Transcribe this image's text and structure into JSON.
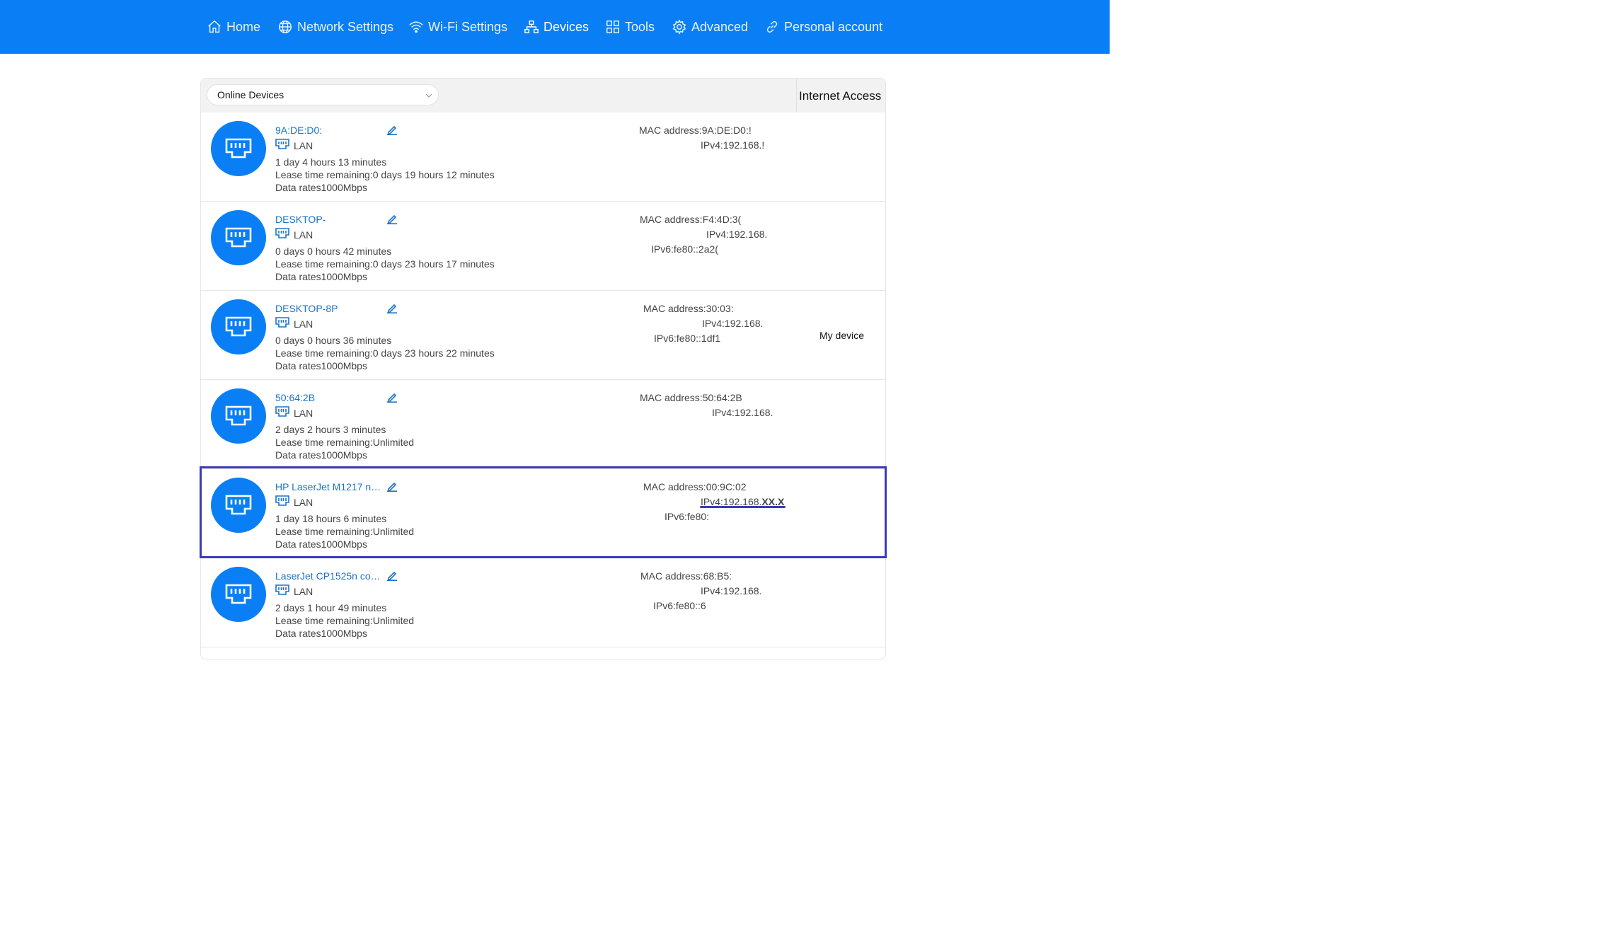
{
  "nav": {
    "items": [
      {
        "label": "Home",
        "icon": "home-icon"
      },
      {
        "label": "Network Settings",
        "icon": "globe-icon"
      },
      {
        "label": "Wi-Fi Settings",
        "icon": "wifi-icon"
      },
      {
        "label": "Devices",
        "icon": "devices-icon",
        "active": true
      },
      {
        "label": "Tools",
        "icon": "tools-icon"
      },
      {
        "label": "Advanced",
        "icon": "gear-icon"
      },
      {
        "label": "Personal account",
        "icon": "link-icon"
      }
    ]
  },
  "colors": {
    "brand": "#0a7ff5",
    "link": "#1a73c9",
    "highlight": "#3b3bb5"
  },
  "filter": {
    "selected": "Online Devices"
  },
  "columns": {
    "internet_access": "Internet Access"
  },
  "devices": [
    {
      "name": "9A:DE:D0:",
      "conn": "LAN",
      "uptime": "1 day 4 hours 13 minutes",
      "lease": "Lease time remaining:0 days 19 hours 12 minutes",
      "rate": "Data rates1000Mbps",
      "mac": "MAC address:9A:DE:D0:!",
      "ipv4": "IPv4:192.168.!",
      "ipv6": "",
      "access": ""
    },
    {
      "name": "DESKTOP-",
      "conn": "LAN",
      "uptime": "0 days 0 hours 42 minutes",
      "lease": "Lease time remaining:0 days 23 hours 17 minutes",
      "rate": "Data rates1000Mbps",
      "mac": "MAC address:F4:4D:3(",
      "ipv4": "IPv4:192.168.",
      "ipv6": "IPv6:fe80::2a2(",
      "access": ""
    },
    {
      "name": "DESKTOP-8P",
      "conn": "LAN",
      "uptime": "0 days 0 hours 36 minutes",
      "lease": "Lease time remaining:0 days 23 hours 22 minutes",
      "rate": "Data rates1000Mbps",
      "mac": "MAC address:30:03:",
      "ipv4": "IPv4:192.168.",
      "ipv6": "IPv6:fe80::1df1",
      "access": "My device"
    },
    {
      "name": "50:64:2B",
      "conn": "LAN",
      "uptime": "2 days 2 hours 3 minutes",
      "lease": "Lease time remaining:Unlimited",
      "rate": "Data rates1000Mbps",
      "mac": "MAC address:50:64:2B",
      "ipv4": "IPv4:192.168.",
      "ipv6": "",
      "access": ""
    },
    {
      "name": "HP LaserJet M1217 n…",
      "conn": "LAN",
      "uptime": "1 day 18 hours 6 minutes",
      "lease": "Lease time remaining:Unlimited",
      "rate": "Data rates1000Mbps",
      "mac": "MAC address:00:9C:02",
      "ipv4": "IPv4:192.168.",
      "ipv4_suffix": "XX.X",
      "ipv6": "IPv6:fe80:",
      "access": ""
    },
    {
      "name": "LaserJet CP1525n co…",
      "conn": "LAN",
      "uptime": "2 days 1 hour 49 minutes",
      "lease": "Lease time remaining:Unlimited",
      "rate": "Data rates1000Mbps",
      "mac": "MAC address:68:B5:",
      "ipv4": "IPv4:192.168.",
      "ipv6": "IPv6:fe80::6",
      "access": ""
    }
  ]
}
